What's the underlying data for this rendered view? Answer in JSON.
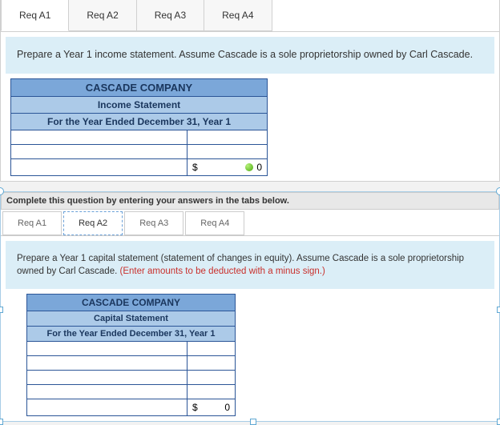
{
  "panel1": {
    "tabs": [
      "Req A1",
      "Req A2",
      "Req A3",
      "Req A4"
    ],
    "activeTab": 0,
    "instruction": "Prepare a Year 1 income statement. Assume Cascade is a sole proprietorship owned by Carl Cascade.",
    "statement": {
      "company": "CASCADE COMPANY",
      "title": "Income Statement",
      "period": "For the Year Ended December 31, Year 1",
      "totalSymbol": "$",
      "totalValue": "0"
    }
  },
  "divider": "Complete this question by entering your answers in the tabs below.",
  "panel2": {
    "tabs": [
      "Req A1",
      "Req A2",
      "Req A3",
      "Req A4"
    ],
    "activeTab": 1,
    "instruction": "Prepare a Year 1 capital statement (statement of changes in equity). Assume Cascade is a sole proprietorship owned by Carl Cascade. ",
    "instructionNote": "(Enter amounts to be deducted with a minus sign.)",
    "statement": {
      "company": "CASCADE COMPANY",
      "title": "Capital Statement",
      "period": "For the Year Ended December 31, Year 1",
      "totalSymbol": "$",
      "totalValue": "0"
    }
  }
}
